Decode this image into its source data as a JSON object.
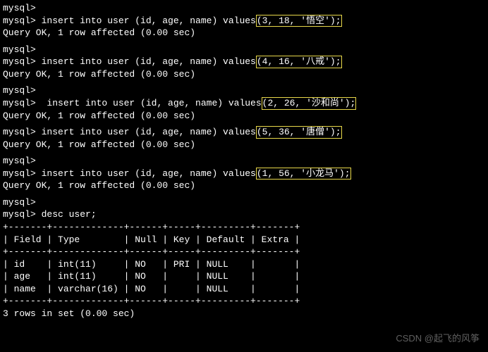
{
  "prompt": "mysql>",
  "inserts": [
    {
      "prefix": " insert into user (id, age, name) values",
      "values": "(3, 18, '悟空');"
    },
    {
      "prefix": " insert into user (id, age, name) values",
      "values": "(4, 16, '八戒');"
    },
    {
      "prefix": "  insert into user (id, age, name) values",
      "values": "(2, 26, '沙和尚');"
    },
    {
      "prefix": " insert into user (id, age, name) values",
      "values": "(5, 36, '唐僧');"
    },
    {
      "prefix": " insert into user (id, age, name) values",
      "values": "(1, 56, '小龙马');"
    }
  ],
  "query_ok": "Query OK, 1 row affected (0.00 sec)",
  "desc_cmd": " desc user;",
  "table": {
    "border": "+-------+-------------+------+-----+---------+-------+",
    "header": "| Field | Type        | Null | Key | Default | Extra |",
    "rows": [
      "| id    | int(11)     | NO   | PRI | NULL    |       |",
      "| age   | int(11)     | NO   |     | NULL    |       |",
      "| name  | varchar(16) | NO   |     | NULL    |       |"
    ]
  },
  "result_footer": "3 rows in set (0.00 sec)",
  "watermark": "CSDN @起飞的风筝",
  "chart_data": {
    "type": "table",
    "title": "desc user",
    "columns": [
      "Field",
      "Type",
      "Null",
      "Key",
      "Default",
      "Extra"
    ],
    "rows": [
      [
        "id",
        "int(11)",
        "NO",
        "PRI",
        "NULL",
        ""
      ],
      [
        "age",
        "int(11)",
        "NO",
        "",
        "NULL",
        ""
      ],
      [
        "name",
        "varchar(16)",
        "NO",
        "",
        "NULL",
        ""
      ]
    ]
  }
}
